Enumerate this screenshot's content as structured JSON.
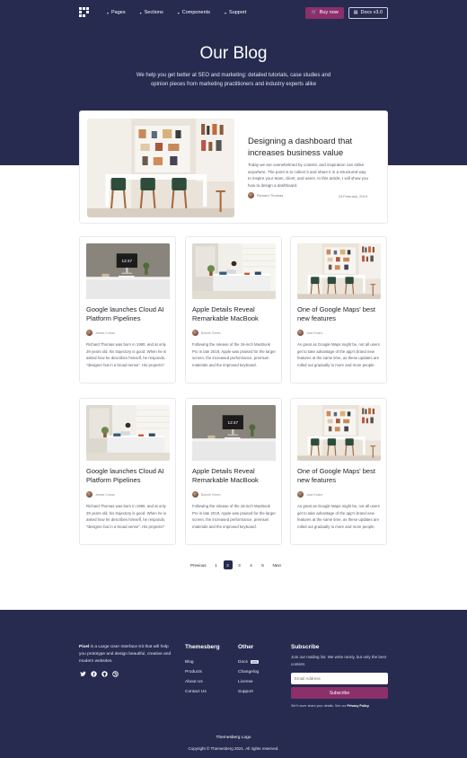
{
  "nav": {
    "links": [
      "Pages",
      "Sections",
      "Components",
      "Support"
    ],
    "buy_label": "Buy now",
    "docs_label": "Docs v3.0"
  },
  "hero": {
    "title": "Our Blog",
    "subtitle": "We help you get better at SEO and marketing: detailed tutorials, case studies and opinion pieces from marketing practitioners and industry experts alike"
  },
  "featured": {
    "title": "Designing a dashboard that increases business value",
    "excerpt": "Today we are overwhelmed by content, and inspiration can strike anywhere. The point is to collect it and share it in a structured way to inspire your team, client, and users. In this article, I will show you how to design a dashboard.",
    "author": "Richard Thomas",
    "date": "23 February, 2019",
    "image": "shelves-room"
  },
  "posts": [
    {
      "title": "Google launches Cloud AI Platform Pipelines",
      "author": "James Curran",
      "excerpt": "Richard Thomas was born in 1990, and at only 29 years old, his trajectory is good. When he is asked how he describes himself, he responds, \"designer but in a broad sense\". His projects?",
      "image": "monitor-desk"
    },
    {
      "title": "Apple Details Reveal Remarkable MacBook",
      "author": "Bonnie Green",
      "excerpt": "Following the release of the 16-inch MacBook Pro in late 2019, Apple was praised for the larger screen, the increased performance, premium materials and the improved keyboard.",
      "image": "person-desk"
    },
    {
      "title": "One of Google Maps' best new features",
      "author": "Jose Evans",
      "excerpt": "As great as Google Maps might be, not all users get to take advantage of the app's brand new features at the same time, as these updates are rolled out gradually to more and more people.",
      "image": "shelves-room"
    },
    {
      "title": "Google launches Cloud AI Platform Pipelines",
      "author": "James Curran",
      "excerpt": "Richard Thomas was born in 1990, and at only 29 years old, his trajectory is good. When he is asked how he describes himself, he responds, \"designer but in a broad sense\". His projects?",
      "image": "person-desk"
    },
    {
      "title": "Apple Details Reveal Remarkable MacBook",
      "author": "Bonnie Green",
      "excerpt": "Following the release of the 16-inch MacBook Pro in late 2019, Apple was praised for the larger screen, the increased performance, premium materials and the improved keyboard.",
      "image": "monitor-desk"
    },
    {
      "title": "One of Google Maps' best new features",
      "author": "Jose Evans",
      "excerpt": "As great as Google Maps might be, not all users get to take advantage of the app's brand new features at the same time, as these updates are rolled out gradually to more and more people.",
      "image": "shelves-room"
    }
  ],
  "pagination": {
    "previous": "Previous",
    "pages": [
      "1",
      "2",
      "3",
      "4",
      "5"
    ],
    "current": "2",
    "next": "Next"
  },
  "footer": {
    "about_brand": "Pixel",
    "about_text": " is a Large User Interface Kit that will help you prototype and design beautiful, creative and modern websites.",
    "socials": [
      "twitter-icon",
      "facebook-icon",
      "github-icon",
      "dribbble-icon"
    ],
    "col1": {
      "title": "Themesberg",
      "links": [
        "Blog",
        "Products",
        "About Us",
        "Contact Us"
      ]
    },
    "col2": {
      "title": "Other",
      "links": [
        "Docs",
        "Changelog",
        "License",
        "Support"
      ],
      "docs_badge": "v3.0"
    },
    "subscribe": {
      "title": "Subscribe",
      "text": "Join our mailing list. We write rarely, but only the best content.",
      "placeholder": "Email Address",
      "button": "Subscribe",
      "note_prefix": "We'll never share your details. See our ",
      "note_link": "Privacy Policy"
    },
    "logo_text": "Themesberg Logo",
    "copyright": "Copyright © Themesberg 2021. All rights reserved."
  },
  "colors": {
    "navy": "#262b4f",
    "accent": "#8c2f6b"
  }
}
